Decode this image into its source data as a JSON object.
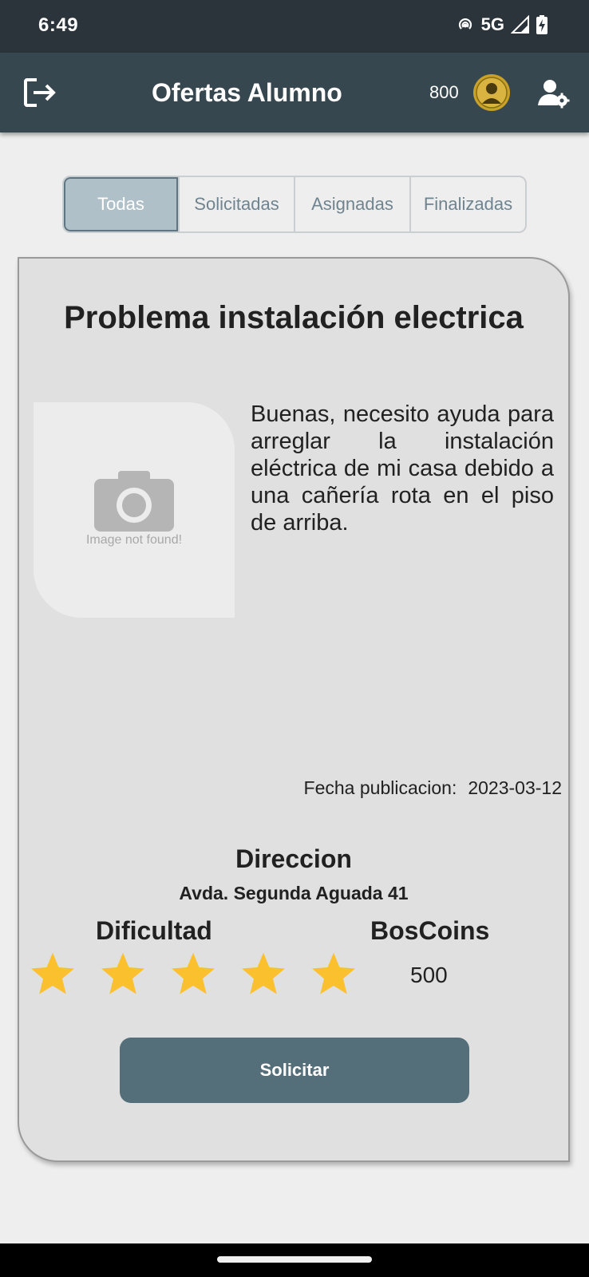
{
  "status_bar": {
    "time": "6:49",
    "network": "5G"
  },
  "app_bar": {
    "title": "Ofertas Alumno",
    "coins": "800",
    "icons": [
      "logout-icon",
      "coin-icon",
      "user-settings-icon"
    ]
  },
  "tabs": [
    {
      "label": "Todas",
      "active": true
    },
    {
      "label": "Solicitadas",
      "active": false
    },
    {
      "label": "Asignadas",
      "active": false
    },
    {
      "label": "Finalizadas",
      "active": false
    }
  ],
  "offer": {
    "title": "Problema instalación electrica",
    "image_error": "Image not found!",
    "description": "Buenas, necesito ayuda para arreglar la instalación eléctrica de mi casa debido a una cañería rota en el piso de arriba.",
    "date_label": "Fecha publicacion:",
    "date_value": "2023-03-12",
    "address_label": "Direccion",
    "address_value": "Avda. Segunda Aguada 41",
    "difficulty_label": "Dificultad",
    "difficulty_stars": 5,
    "coins_label": "BosCoins",
    "coins_value": "500",
    "button_label": "Solicitar"
  },
  "colors": {
    "status_bar": "#2b333b",
    "app_bar": "#37474f",
    "tab_active": "#b0c0c8",
    "tab_text": "#6f848f",
    "card_bg": "#e0e0e0",
    "button": "#546e7a",
    "star": "#fbc02d"
  }
}
